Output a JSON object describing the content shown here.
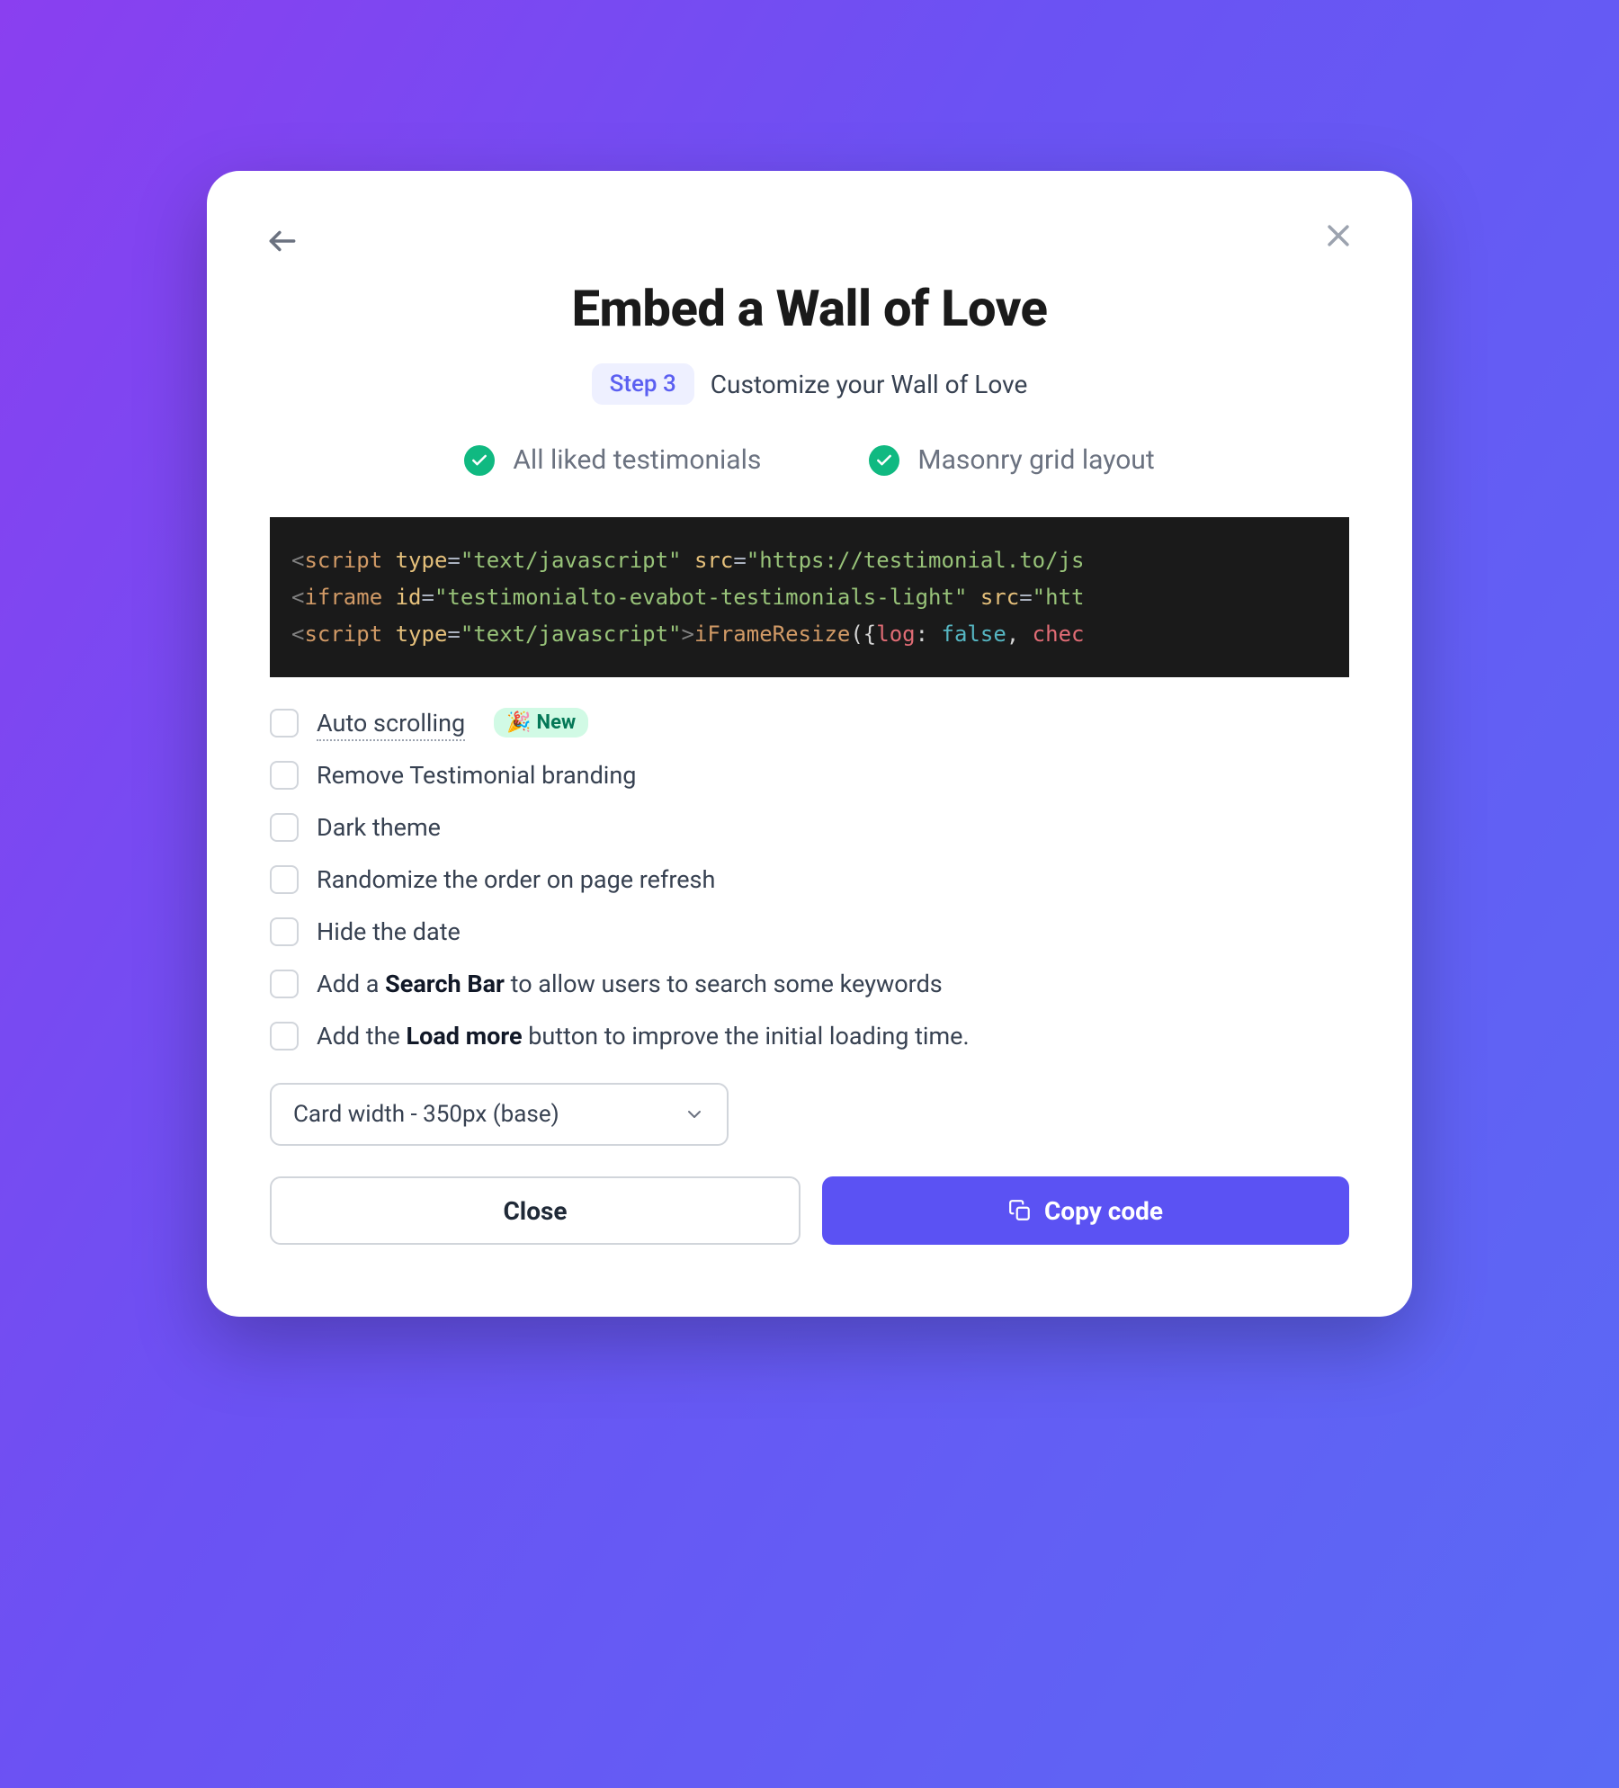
{
  "modal": {
    "title": "Embed a Wall of Love",
    "step_badge": "Step 3",
    "step_description": "Customize your Wall of Love",
    "checks": [
      {
        "label": "All liked testimonials"
      },
      {
        "label": "Masonry grid layout"
      }
    ],
    "code": {
      "line1": {
        "tag": "script",
        "attr1_name": "type",
        "attr1_val": "\"text/javascript\"",
        "attr2_name": "src",
        "attr2_val": "\"https://testimonial.to/js"
      },
      "line2": {
        "tag": "iframe",
        "attr1_name": "id",
        "attr1_val": "\"testimonialto-evabot-testimonials-light\"",
        "attr2_name": "src",
        "attr2_val": "\"htt"
      },
      "line3": {
        "tag": "script",
        "attr1_name": "type",
        "attr1_val": "\"text/javascript\"",
        "fn": "iFrameResize",
        "paren_open": "({",
        "key1": "log",
        "colon": ": ",
        "val1": "false",
        "comma": ", ",
        "key2": "chec"
      }
    },
    "options": [
      {
        "label": "Auto scrolling",
        "new": true,
        "underline": true
      },
      {
        "label": "Remove Testimonial branding"
      },
      {
        "label": "Dark theme"
      },
      {
        "label": "Randomize the order on page refresh"
      },
      {
        "label": "Hide the date"
      },
      {
        "label_pre": "Add a ",
        "label_bold": "Search Bar",
        "label_post": " to allow users to search some keywords"
      },
      {
        "label_pre": "Add the ",
        "label_bold": "Load more",
        "label_post": " button to improve the initial loading time."
      }
    ],
    "new_badge": "New",
    "select_value": "Card width - 350px (base)",
    "close_button": "Close",
    "copy_button": "Copy code"
  }
}
